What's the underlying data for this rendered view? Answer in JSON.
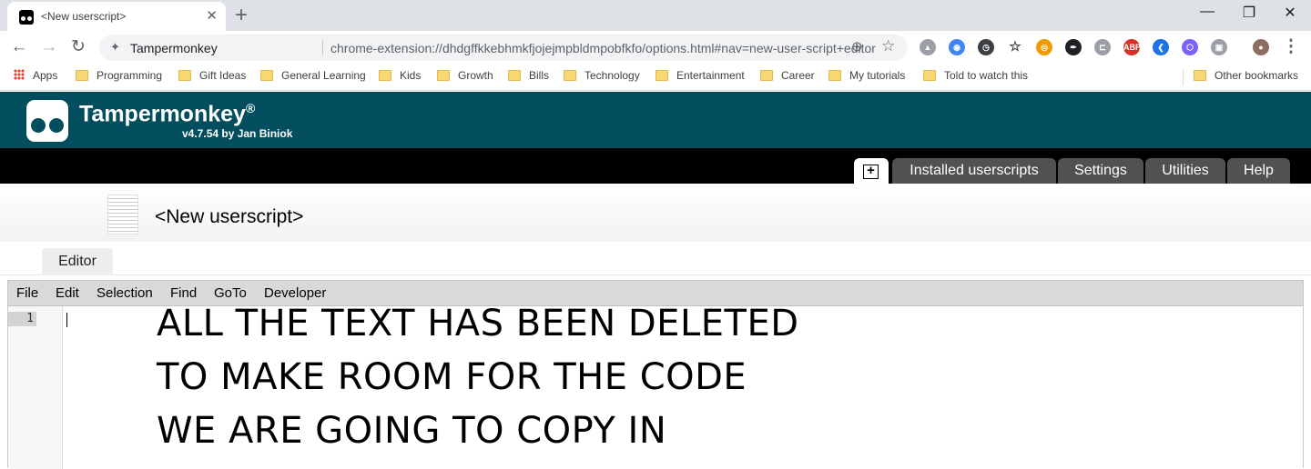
{
  "browser": {
    "tab_title": "<New userscript>",
    "tab_close": "✕",
    "new_tab": "+",
    "window_controls": {
      "minimize": "—",
      "maximize": "❐",
      "close": "✕"
    },
    "nav": {
      "back": "←",
      "forward": "→",
      "reload": "↻"
    },
    "omnibox": {
      "origin_label": "Tampermonkey",
      "url": "chrome-extension://dhdgffkkebhmkfjojejmpbldmpobfkfo/options.html#nav=new-user-script+editor",
      "zoom_icon": "⊕",
      "star_icon": "☆"
    },
    "extensions": [
      {
        "name": "drive-icon",
        "color": "#9aa0a6",
        "glyph": "▲"
      },
      {
        "name": "chrome-color-icon",
        "color": "#4285f4",
        "glyph": "◉"
      },
      {
        "name": "clock-icon",
        "color": "#3c4043",
        "glyph": "◷"
      },
      {
        "name": "star-outline-icon",
        "color": "#ffffff",
        "glyph": "☆"
      },
      {
        "name": "owl-icon",
        "color": "#f29900",
        "glyph": "◎"
      },
      {
        "name": "feather-icon",
        "color": "#202124",
        "glyph": "✒"
      },
      {
        "name": "bracket-icon",
        "color": "#9aa0a6",
        "glyph": "⊏"
      },
      {
        "name": "adblock-icon",
        "color": "#d93025",
        "glyph": "ABP"
      },
      {
        "name": "clickup-icon",
        "color": "#1a73e8",
        "glyph": "❮"
      },
      {
        "name": "hexagon-icon",
        "color": "#7b61ff",
        "glyph": "⬡"
      },
      {
        "name": "tampermonkey-ext-icon",
        "color": "#9aa0a6",
        "glyph": "▣"
      },
      {
        "name": "profile-avatar",
        "color": "#8d6e63",
        "glyph": "●"
      }
    ],
    "menu_icon": "⋮"
  },
  "bookmarks": {
    "apps": "Apps",
    "folders": [
      "Programming",
      "Gift Ideas",
      "General Learning",
      "Kids",
      "Growth",
      "Bills",
      "Technology",
      "Entertainment",
      "Career",
      "My tutorials",
      "Told to watch this"
    ],
    "other": "Other bookmarks"
  },
  "tampermonkey": {
    "name": "Tampermonkey",
    "registered": "®",
    "version": "v4.7.54 by Jan Biniok",
    "nav_new_icon": "+",
    "nav_tabs": [
      "Installed userscripts",
      "Settings",
      "Utilities",
      "Help"
    ]
  },
  "script": {
    "title": "<New userscript>",
    "editor_tab": "Editor"
  },
  "editor": {
    "menu": [
      "File",
      "Edit",
      "Selection",
      "Find",
      "GoTo",
      "Developer"
    ],
    "line_number": "1",
    "overlay_lines": [
      "ALL THE TEXT HAS BEEN DELETED",
      "TO MAKE ROOM FOR THE CODE",
      "WE ARE GOING TO COPY IN"
    ]
  }
}
